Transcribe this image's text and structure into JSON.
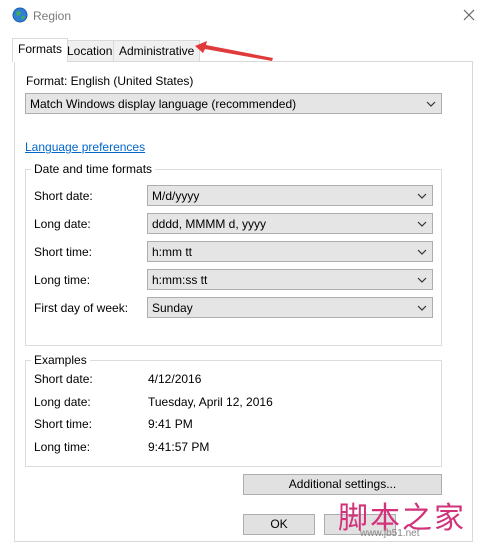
{
  "window": {
    "title": "Region"
  },
  "tabs": [
    {
      "label": "Formats"
    },
    {
      "label": "Location"
    },
    {
      "label": "Administrative"
    }
  ],
  "format": {
    "label": "Format: English (United States)",
    "value": "Match Windows display language (recommended)"
  },
  "language_preferences_link": "Language preferences",
  "date_time_group": {
    "title": "Date and time formats",
    "rows": [
      {
        "label": "Short date:",
        "value": "M/d/yyyy"
      },
      {
        "label": "Long date:",
        "value": "dddd, MMMM d, yyyy"
      },
      {
        "label": "Short time:",
        "value": "h:mm tt"
      },
      {
        "label": "Long time:",
        "value": "h:mm:ss tt"
      },
      {
        "label": "First day of week:",
        "value": "Sunday"
      }
    ]
  },
  "examples_group": {
    "title": "Examples",
    "rows": [
      {
        "label": "Short date:",
        "value": "4/12/2016"
      },
      {
        "label": "Long date:",
        "value": "Tuesday, April 12, 2016"
      },
      {
        "label": "Short time:",
        "value": "9:41 PM"
      },
      {
        "label": "Long time:",
        "value": "9:41:57 PM"
      }
    ]
  },
  "buttons": {
    "additional_settings": "Additional settings...",
    "ok": "OK"
  },
  "watermark": {
    "text": "脚本之家",
    "url": "www.jb51.net"
  },
  "colors": {
    "link": "#0066cc",
    "annotation_arrow": "#e03a3a",
    "watermark": "#d2327a"
  },
  "icons": {
    "app": "globe-icon",
    "close": "close-icon",
    "dropdown": "chevron-down-icon"
  }
}
